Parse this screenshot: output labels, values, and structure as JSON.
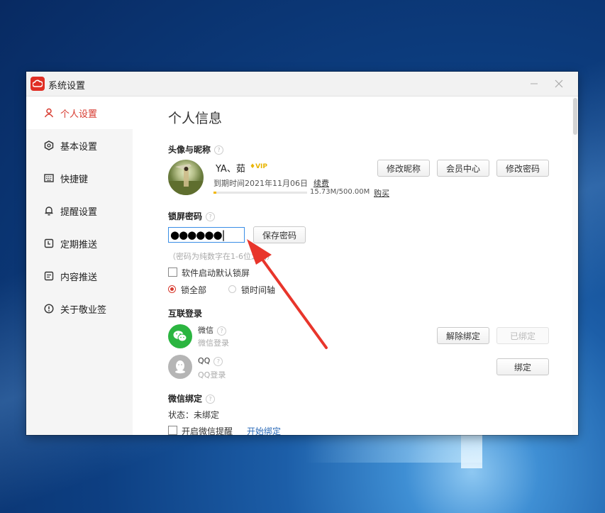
{
  "window": {
    "title": "系统设置"
  },
  "sidebar": {
    "items": [
      {
        "label": "个人设置",
        "icon": "user-icon",
        "active": true
      },
      {
        "label": "基本设置",
        "icon": "settings-icon"
      },
      {
        "label": "快捷键",
        "icon": "keyboard-icon"
      },
      {
        "label": "提醒设置",
        "icon": "bell-icon"
      },
      {
        "label": "定期推送",
        "icon": "schedule-icon"
      },
      {
        "label": "内容推送",
        "icon": "content-icon"
      },
      {
        "label": "关于敬业签",
        "icon": "info-icon"
      }
    ]
  },
  "main": {
    "heading": "个人信息",
    "profile": {
      "section_title": "头像与昵称",
      "username": "YA、茹",
      "vip_badge": "VIP",
      "expire_text": "到期时间2021年11月06日",
      "renew_link": "续费",
      "storage_text": "15.73M/500.00M",
      "storage_fraction": 0.03,
      "buy_link": "购买",
      "buttons": {
        "edit_nickname": "修改昵称",
        "member_center": "会员中心",
        "change_password": "修改密码"
      }
    },
    "lock": {
      "section_title": "锁屏密码",
      "password_value": "●●●●●●",
      "save_button": "保存密码",
      "hint": "（密码为纯数字在1-6位之间）",
      "startup_lock_label": "软件启动默认锁屏",
      "startup_lock_checked": false,
      "lock_all_label": "锁全部",
      "lock_timeline_label": "锁时间轴",
      "lock_mode": "lock_all"
    },
    "connect": {
      "section_title": "互联登录",
      "wechat": {
        "name": "微信",
        "sub": "微信登录",
        "unbind_button": "解除绑定",
        "bound_button": "已绑定"
      },
      "qq": {
        "name": "QQ",
        "sub": "QQ登录",
        "bind_button": "绑定"
      }
    },
    "wechat_bind": {
      "section_title": "微信绑定",
      "status": "状态：未绑定",
      "reminder_label": "开启微信提醒",
      "reminder_checked": false,
      "start_bind_link": "开始绑定"
    }
  },
  "colors": {
    "accent": "#d73a2f",
    "wechat": "#2bb540",
    "qq_disabled": "#b5b5b5",
    "vip": "#e8b400",
    "link": "#2a6ab8",
    "annotation_arrow": "#e8352b"
  }
}
